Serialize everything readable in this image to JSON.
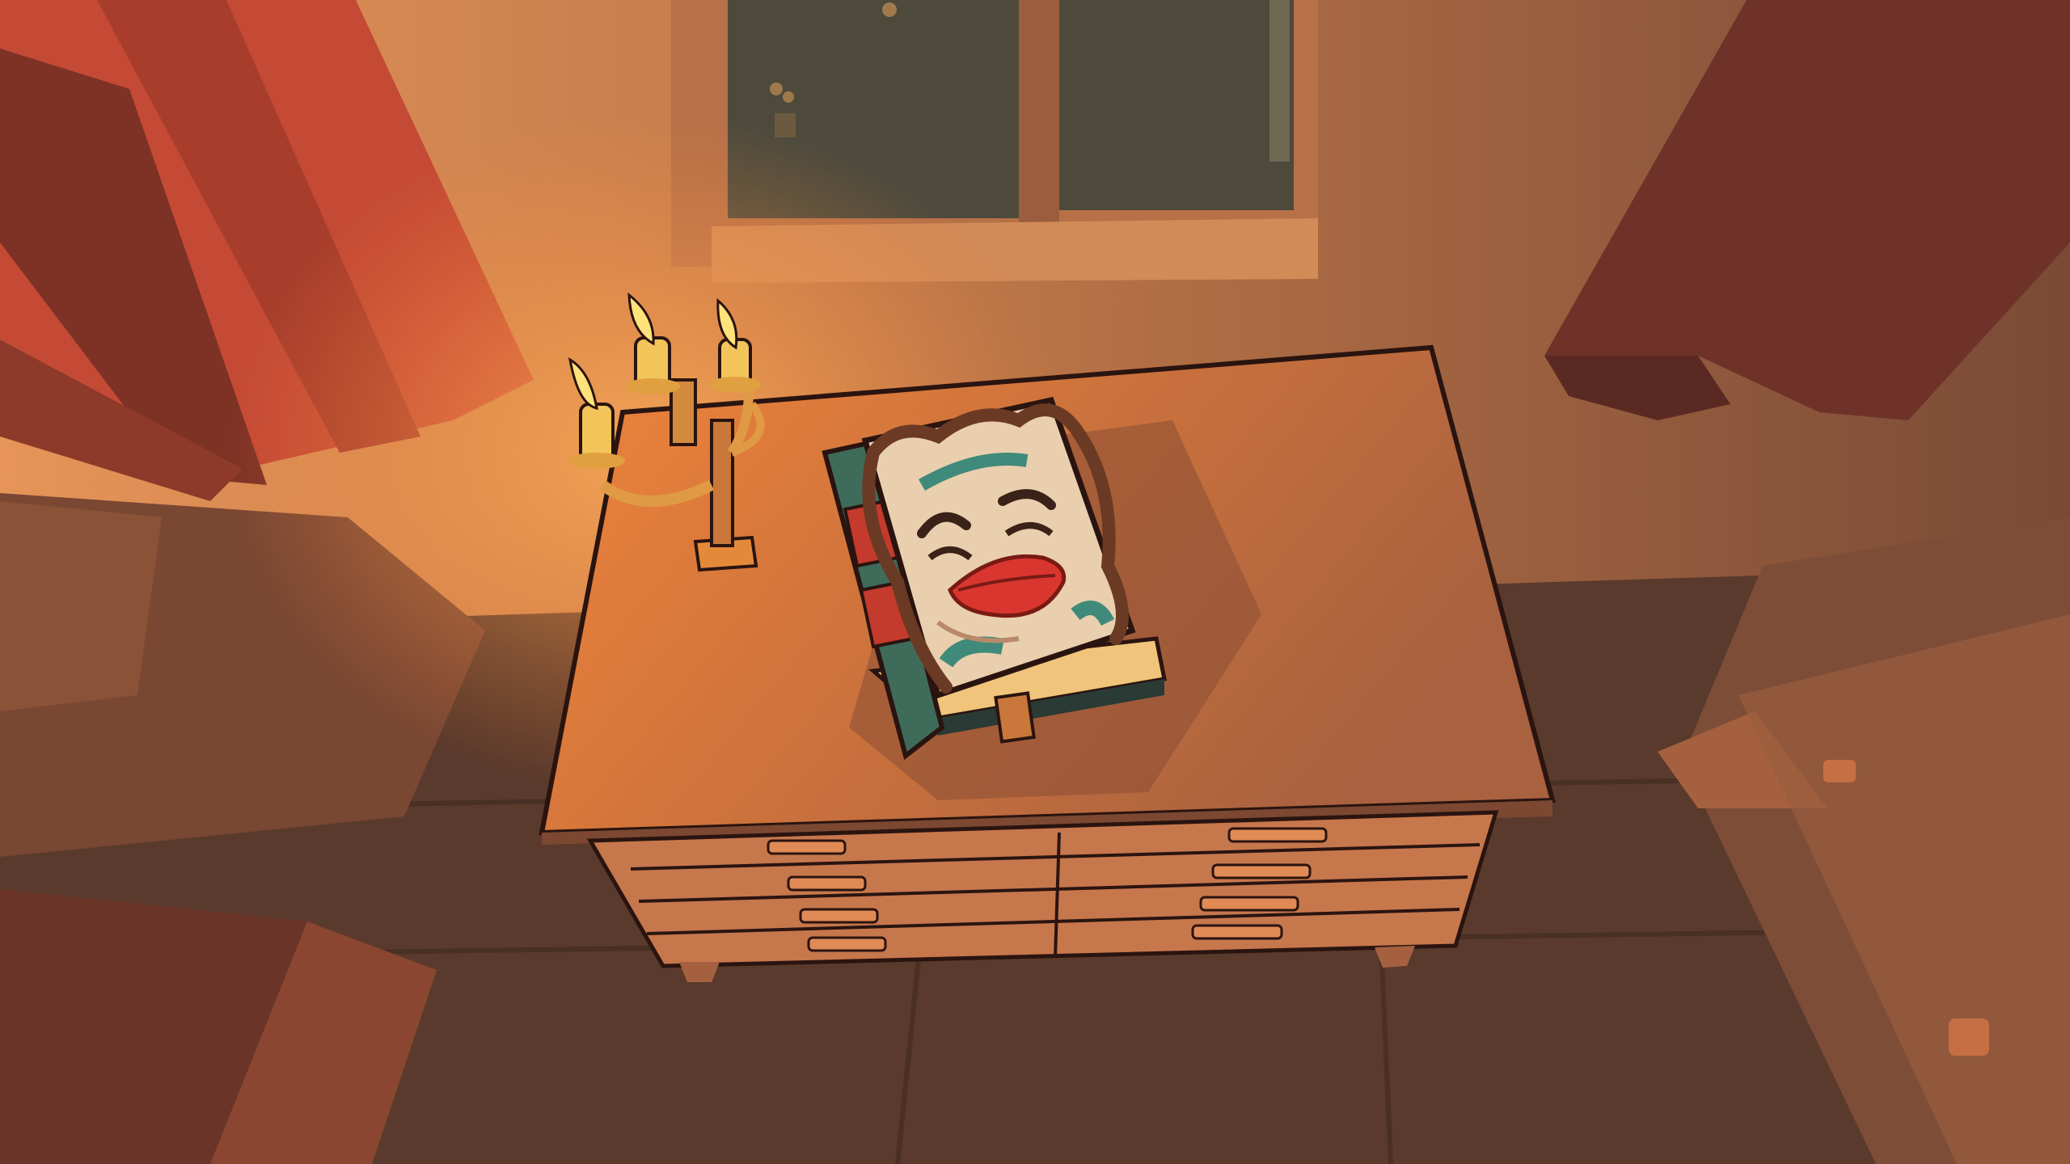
{
  "scene": {
    "palette": {
      "wall": "#c27a4e",
      "wall_dark": "#8a5236",
      "floor": "#5a3a2c",
      "curtain": "#c44a35",
      "curtain_dark": "#7e3226",
      "window_glass": "#4d4a3c",
      "candle_flame": "#ffe27a",
      "candle_wax": "#f2c45a",
      "dresser_top": "#f0843a",
      "dresser_front": "#c7774c",
      "book_cover": "#e9cfae",
      "book_spine": "#3f6b5a",
      "book_band": "#c43a2c",
      "lips": "#d8362e",
      "brow": "#3a2218",
      "outline": "#2a1410"
    },
    "objects": {
      "candles_lit": 3,
      "dresser_drawer_rows": 4,
      "window_panes": 2
    }
  }
}
